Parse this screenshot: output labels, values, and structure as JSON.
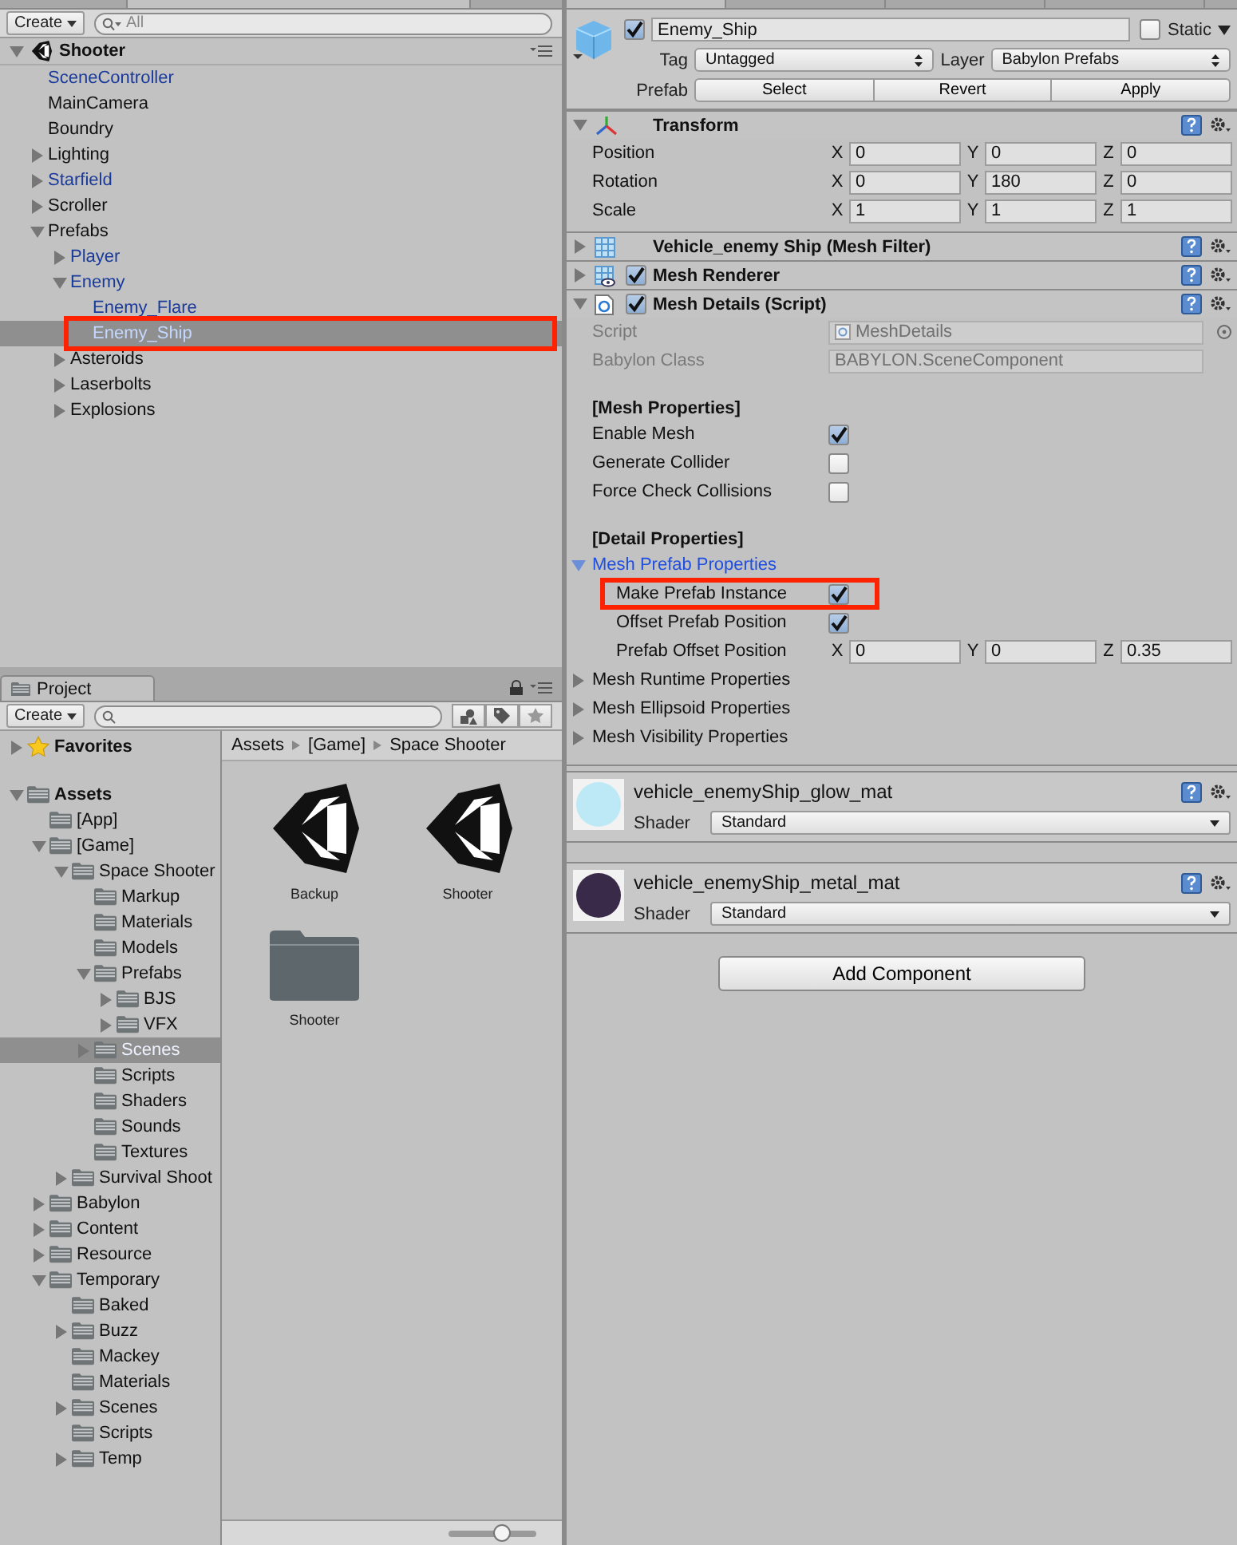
{
  "hierarchy": {
    "create": "Create",
    "search_placeholder": "All",
    "scene": {
      "name": "Shooter",
      "expanded": true
    },
    "items": [
      {
        "name": "SceneController",
        "prefab": true,
        "expandable": false,
        "expanded": false,
        "selected": false,
        "annotated": false
      },
      {
        "name": "MainCamera",
        "prefab": false,
        "expandable": false,
        "expanded": false,
        "selected": false,
        "annotated": false
      },
      {
        "name": "Boundry",
        "prefab": false,
        "expandable": false,
        "expanded": false,
        "selected": false,
        "annotated": false
      },
      {
        "name": "Lighting",
        "prefab": false,
        "expandable": true,
        "expanded": false,
        "selected": false,
        "annotated": false
      },
      {
        "name": "Starfield",
        "prefab": true,
        "expandable": true,
        "expanded": false,
        "selected": false,
        "annotated": false
      },
      {
        "name": "Scroller",
        "prefab": false,
        "expandable": true,
        "expanded": false,
        "selected": false,
        "annotated": false
      },
      {
        "name": "Prefabs",
        "prefab": false,
        "expandable": true,
        "expanded": true,
        "selected": false,
        "annotated": false,
        "children": [
          {
            "name": "Player",
            "prefab": true,
            "expandable": true,
            "expanded": false,
            "selected": false,
            "annotated": false
          },
          {
            "name": "Enemy",
            "prefab": true,
            "expandable": true,
            "expanded": true,
            "selected": false,
            "annotated": false,
            "children": [
              {
                "name": "Enemy_Flare",
                "prefab": true,
                "expandable": false,
                "expanded": false,
                "selected": false,
                "annotated": false
              },
              {
                "name": "Enemy_Ship",
                "prefab": true,
                "expandable": false,
                "expanded": false,
                "selected": true,
                "annotated": true
              }
            ]
          },
          {
            "name": "Asteroids",
            "prefab": false,
            "expandable": true,
            "expanded": false,
            "selected": false,
            "annotated": false
          },
          {
            "name": "Laserbolts",
            "prefab": false,
            "expandable": true,
            "expanded": false,
            "selected": false,
            "annotated": false
          },
          {
            "name": "Explosions",
            "prefab": false,
            "expandable": true,
            "expanded": false,
            "selected": false,
            "annotated": false
          }
        ]
      }
    ]
  },
  "project": {
    "tab": "Project",
    "create": "Create",
    "tree": [
      {
        "name": "Favorites",
        "kind": "favorites",
        "expandable": true,
        "expanded": false,
        "selected": false
      },
      {
        "name": "Assets",
        "kind": "root",
        "expandable": true,
        "expanded": true,
        "selected": false,
        "children": [
          {
            "name": "[App]",
            "kind": "folder",
            "expandable": false,
            "expanded": false,
            "selected": false
          },
          {
            "name": "[Game]",
            "kind": "folder",
            "expandable": true,
            "expanded": true,
            "selected": false,
            "children": [
              {
                "name": "Space Shooter",
                "kind": "folder",
                "expandable": true,
                "expanded": true,
                "selected": false,
                "children": [
                  {
                    "name": "Markup",
                    "kind": "folder",
                    "expandable": false,
                    "expanded": false,
                    "selected": false
                  },
                  {
                    "name": "Materials",
                    "kind": "folder",
                    "expandable": false,
                    "expanded": false,
                    "selected": false
                  },
                  {
                    "name": "Models",
                    "kind": "folder",
                    "expandable": false,
                    "expanded": false,
                    "selected": false
                  },
                  {
                    "name": "Prefabs",
                    "kind": "folder",
                    "expandable": true,
                    "expanded": true,
                    "selected": false,
                    "children": [
                      {
                        "name": "BJS",
                        "kind": "folder",
                        "expandable": true,
                        "expanded": false,
                        "selected": false
                      },
                      {
                        "name": "VFX",
                        "kind": "folder",
                        "expandable": true,
                        "expanded": false,
                        "selected": false
                      }
                    ]
                  },
                  {
                    "name": "Scenes",
                    "kind": "folder",
                    "expandable": true,
                    "expanded": false,
                    "selected": true
                  },
                  {
                    "name": "Scripts",
                    "kind": "folder",
                    "expandable": false,
                    "expanded": false,
                    "selected": false
                  },
                  {
                    "name": "Shaders",
                    "kind": "folder",
                    "expandable": false,
                    "expanded": false,
                    "selected": false
                  },
                  {
                    "name": "Sounds",
                    "kind": "folder",
                    "expandable": false,
                    "expanded": false,
                    "selected": false
                  },
                  {
                    "name": "Textures",
                    "kind": "folder",
                    "expandable": false,
                    "expanded": false,
                    "selected": false
                  }
                ]
              },
              {
                "name": "Survival Shoot",
                "kind": "folder",
                "expandable": true,
                "expanded": false,
                "selected": false
              }
            ]
          },
          {
            "name": "Babylon",
            "kind": "folder",
            "expandable": true,
            "expanded": false,
            "selected": false
          },
          {
            "name": "Content",
            "kind": "folder",
            "expandable": true,
            "expanded": false,
            "selected": false
          },
          {
            "name": "Resource",
            "kind": "folder",
            "expandable": true,
            "expanded": false,
            "selected": false
          },
          {
            "name": "Temporary",
            "kind": "folder",
            "expandable": true,
            "expanded": true,
            "selected": false,
            "children": [
              {
                "name": "Baked",
                "kind": "folder",
                "expandable": false,
                "expanded": false,
                "selected": false
              },
              {
                "name": "Buzz",
                "kind": "folder",
                "expandable": true,
                "expanded": false,
                "selected": false
              },
              {
                "name": "Mackey",
                "kind": "folder",
                "expandable": false,
                "expanded": false,
                "selected": false
              },
              {
                "name": "Materials",
                "kind": "folder",
                "expandable": false,
                "expanded": false,
                "selected": false
              },
              {
                "name": "Scenes",
                "kind": "folder",
                "expandable": true,
                "expanded": false,
                "selected": false
              },
              {
                "name": "Scripts",
                "kind": "folder",
                "expandable": false,
                "expanded": false,
                "selected": false
              },
              {
                "name": "Temp",
                "kind": "folder",
                "expandable": true,
                "expanded": false,
                "selected": false
              }
            ]
          }
        ]
      }
    ],
    "breadcrumb": [
      "Assets",
      "[Game]",
      "Space Shooter"
    ],
    "assets": [
      {
        "name": "Backup",
        "kind": "scene"
      },
      {
        "name": "Shooter",
        "kind": "scene"
      },
      {
        "name": "Shooter",
        "kind": "folder"
      }
    ],
    "zoom": {
      "level": 0.6
    }
  },
  "inspector": {
    "active": true,
    "name": "Enemy_Ship",
    "static": false,
    "static_label": "Static",
    "tag_label": "Tag",
    "tag": "Untagged",
    "layer_label": "Layer",
    "layer": "Babylon Prefabs",
    "prefab_label": "Prefab",
    "prefab_buttons": [
      "Select",
      "Revert",
      "Apply"
    ],
    "components": [
      {
        "kind": "transform",
        "title": "Transform",
        "expanded": true,
        "fields": [
          {
            "kind": "vector",
            "label": "Position",
            "values": [
              {
                "axis": "X",
                "value": "0"
              },
              {
                "axis": "Y",
                "value": "0"
              },
              {
                "axis": "Z",
                "value": "0"
              }
            ]
          },
          {
            "kind": "vector",
            "label": "Rotation",
            "values": [
              {
                "axis": "X",
                "value": "0"
              },
              {
                "axis": "Y",
                "value": "180"
              },
              {
                "axis": "Z",
                "value": "0"
              }
            ]
          },
          {
            "kind": "vector",
            "label": "Scale",
            "values": [
              {
                "axis": "X",
                "value": "1"
              },
              {
                "axis": "Y",
                "value": "1"
              },
              {
                "axis": "Z",
                "value": "1"
              }
            ]
          }
        ]
      },
      {
        "kind": "mesh_filter",
        "title": "Vehicle_enemy Ship (Mesh Filter)",
        "expanded": false
      },
      {
        "kind": "mesh_renderer",
        "title": "Mesh Renderer",
        "expanded": false,
        "enabled": true
      },
      {
        "kind": "script",
        "title": "Mesh Details (Script)",
        "expanded": true,
        "enabled": true,
        "fields": [
          {
            "kind": "object",
            "label": "Script",
            "value": "MeshDetails",
            "disabled": true
          },
          {
            "kind": "text",
            "label": "Babylon Class",
            "value": "BABYLON.SceneComponent",
            "disabled": true
          },
          {
            "kind": "header",
            "label": "[Mesh Properties]"
          },
          {
            "kind": "toggle",
            "label": "Enable Mesh",
            "checked": true,
            "annotated": false
          },
          {
            "kind": "toggle",
            "label": "Generate Collider",
            "checked": false,
            "annotated": false
          },
          {
            "kind": "toggle",
            "label": "Force Check Collisions",
            "checked": false,
            "annotated": false
          },
          {
            "kind": "header",
            "label": "[Detail Properties]"
          },
          {
            "kind": "foldout",
            "label": "Mesh Prefab Properties",
            "expanded": true,
            "focused": true,
            "children": [
              {
                "kind": "toggle",
                "label": "Make Prefab Instance",
                "checked": true,
                "annotated": true
              },
              {
                "kind": "toggle",
                "label": "Offset Prefab Position",
                "checked": true,
                "annotated": false
              },
              {
                "kind": "vector",
                "label": "Prefab Offset Position",
                "values": [
                  {
                    "axis": "X",
                    "value": "0"
                  },
                  {
                    "axis": "Y",
                    "value": "0"
                  },
                  {
                    "axis": "Z",
                    "value": "0.35"
                  }
                ]
              }
            ]
          },
          {
            "kind": "foldout",
            "label": "Mesh Runtime Properties",
            "expanded": false,
            "focused": false
          },
          {
            "kind": "foldout",
            "label": "Mesh Ellipsoid Properties",
            "expanded": false,
            "focused": false
          },
          {
            "kind": "foldout",
            "label": "Mesh Visibility Properties",
            "expanded": false,
            "focused": false
          }
        ]
      }
    ],
    "materials": [
      {
        "name": "vehicle_enemyShip_glow_mat",
        "shader_label": "Shader",
        "shader": "Standard",
        "color": "#bde9f7"
      },
      {
        "name": "vehicle_enemyShip_metal_mat",
        "shader_label": "Shader",
        "shader": "Standard",
        "color": "#3a2a4a"
      }
    ],
    "add_component": "Add Component"
  }
}
